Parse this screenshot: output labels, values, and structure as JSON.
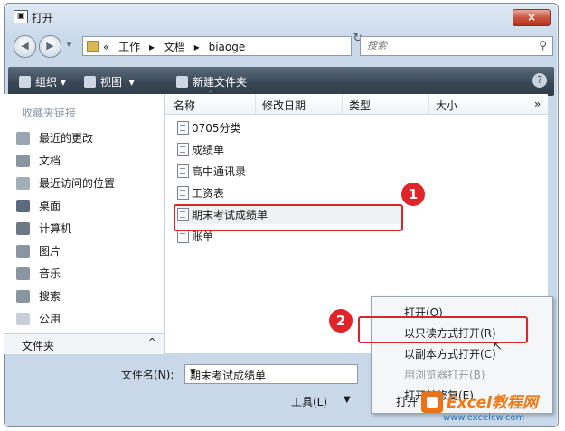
{
  "window": {
    "title": "打开",
    "close_label": "×"
  },
  "nav": {
    "back_icon": "back-arrow-icon",
    "forward_icon": "forward-arrow-icon"
  },
  "address": {
    "prefix": "«",
    "crumbs": [
      "工作",
      "文档",
      "biaoge"
    ],
    "separator": "▸",
    "dropdown_glyph": "▾",
    "refresh_glyph": "↻"
  },
  "search": {
    "placeholder": "搜索"
  },
  "toolbar": {
    "organize": "组织",
    "views": "视图",
    "new_folder": "新建文件夹",
    "help": "?"
  },
  "sidebar": {
    "header": "收藏夹链接",
    "items": [
      {
        "label": "最近的更改",
        "icon": "recent-changes-icon",
        "color": "#9aa6b3"
      },
      {
        "label": "文档",
        "icon": "documents-icon",
        "color": "#8b95a1"
      },
      {
        "label": "最近访问的位置",
        "icon": "recent-places-icon",
        "color": "#a3adb8"
      },
      {
        "label": "桌面",
        "icon": "desktop-icon",
        "color": "#5b6b7c"
      },
      {
        "label": "计算机",
        "icon": "computer-icon",
        "color": "#6d7884"
      },
      {
        "label": "图片",
        "icon": "pictures-icon",
        "color": "#8b95a1"
      },
      {
        "label": "音乐",
        "icon": "music-icon",
        "color": "#8b95a1"
      },
      {
        "label": "搜索",
        "icon": "search-folder-icon",
        "color": "#8b95a1"
      },
      {
        "label": "公用",
        "icon": "public-icon",
        "color": "#c9cfd6"
      }
    ],
    "folders_label": "文件夹",
    "folders_toggle": "^"
  },
  "columns": {
    "name": "名称",
    "modified": "修改日期",
    "type": "类型",
    "size": "大小",
    "more": "»"
  },
  "files": [
    "0705分类",
    "成绩单",
    "高中通讯录",
    "工资表",
    "期末考试成绩单",
    "账单"
  ],
  "callouts": [
    "1",
    "2"
  ],
  "context_menu": {
    "items": [
      {
        "label": "打开(O)",
        "disabled": false
      },
      {
        "label": "以只读方式打开(R)",
        "disabled": false
      },
      {
        "label": "以副本方式打开(C)",
        "disabled": false
      },
      {
        "label": "用浏览器打开(B)",
        "disabled": true
      },
      {
        "label": "打开并修复(E)",
        "disabled": false
      }
    ]
  },
  "bottom": {
    "filename_label": "文件名(N):",
    "filename_value": "期末考试成绩单",
    "tools_label": "工具(L)",
    "open_label": "打开"
  },
  "watermark": {
    "brand": "Excel教程网",
    "url": "www.excelcw.com"
  },
  "colors": {
    "accent_red": "#d9262b",
    "toolbar_dark": "#3a4856"
  }
}
